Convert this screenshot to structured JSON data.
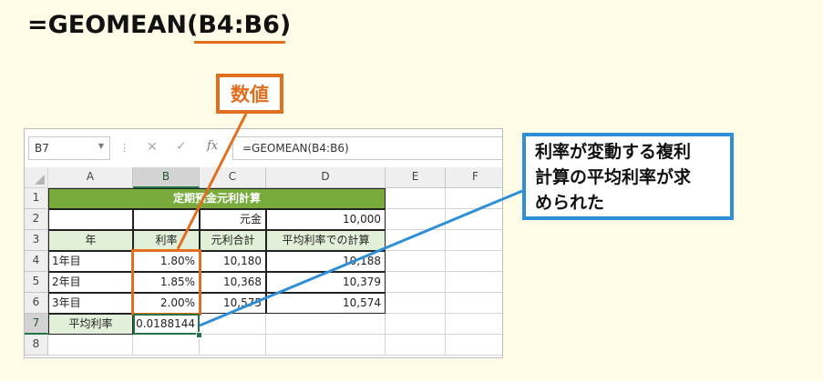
{
  "heading": {
    "formula_prefix": "=GEOMEAN(",
    "formula_arg": "B4:B6",
    "formula_suffix": ")"
  },
  "callouts": {
    "orange": "数値",
    "blue_lines": [
      "利率が変動する複利",
      "計算の平均利率が求",
      "められた"
    ]
  },
  "colors": {
    "accent_orange": "#e07020",
    "accent_blue": "#2f8fd6",
    "title_green": "#78ab3c",
    "light_green": "#e2efd9",
    "background": "#fefbe6"
  },
  "excel": {
    "name_box": "B7",
    "formula_bar": "=GEOMEAN(B4:B6)",
    "icons": {
      "cancel": "✕",
      "enter": "✓",
      "fx": "fx"
    },
    "column_headers": [
      "A",
      "B",
      "C",
      "D",
      "E",
      "F"
    ],
    "row_headers": [
      "1",
      "2",
      "3",
      "4",
      "5",
      "6",
      "7",
      "8"
    ],
    "title": "定期預金元利計算",
    "principal_label": "元金",
    "principal_value": "10,000",
    "table_headers": [
      "年",
      "利率",
      "元利合計",
      "平均利率での計算"
    ],
    "rows": [
      {
        "year": "1年目",
        "rate": "1.80%",
        "total": "10,180",
        "avg_calc": "10,188"
      },
      {
        "year": "2年目",
        "rate": "1.85%",
        "total": "10,368",
        "avg_calc": "10,379"
      },
      {
        "year": "3年目",
        "rate": "2.00%",
        "total": "10,575",
        "avg_calc": "10,574"
      }
    ],
    "avg_label": "平均利率",
    "avg_value": "0.0188144"
  }
}
